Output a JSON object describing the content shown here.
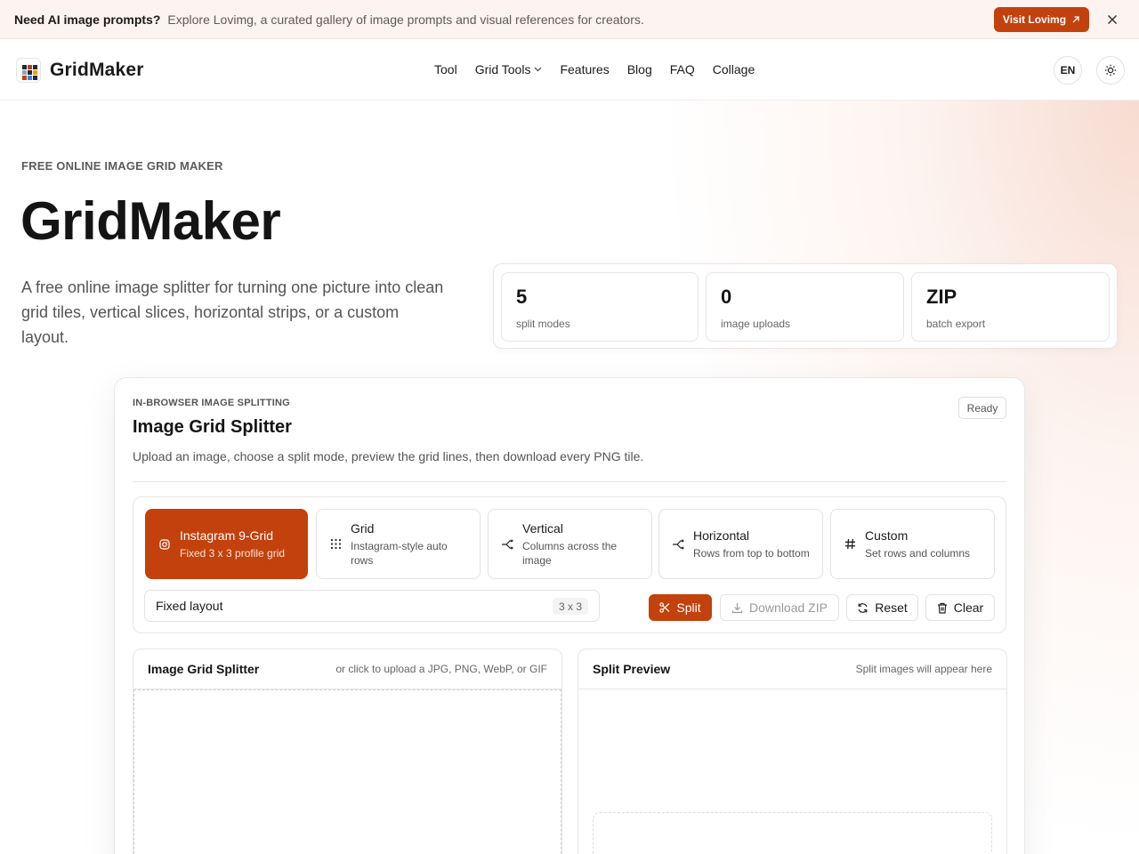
{
  "banner": {
    "headline": "Need AI image prompts?",
    "description": "Explore Lovimg, a curated gallery of image prompts and visual references for creators.",
    "cta_label": "Visit Lovimg",
    "cta_icon": "arrow-up-right-icon",
    "close_icon": "close-icon"
  },
  "nav": {
    "brand": "GridMaker",
    "items": [
      {
        "label": "Tool"
      },
      {
        "label": "Grid Tools",
        "has_dropdown": true
      },
      {
        "label": "Features"
      },
      {
        "label": "Blog"
      },
      {
        "label": "FAQ"
      },
      {
        "label": "Collage"
      }
    ],
    "language": "EN",
    "theme_icon": "sun-icon"
  },
  "hero": {
    "eyebrow": "FREE ONLINE IMAGE GRID MAKER",
    "title": "GridMaker",
    "subtitle": "A free online image splitter for turning one picture into clean grid tiles, vertical slices, horizontal strips, or a custom layout.",
    "stats": [
      {
        "value": "5",
        "label": "split modes"
      },
      {
        "value": "0",
        "label": "image uploads"
      },
      {
        "value": "ZIP",
        "label": "batch export"
      }
    ]
  },
  "tool": {
    "caption": "IN-BROWSER IMAGE SPLITTING",
    "title": "Image Grid Splitter",
    "description": "Upload an image, choose a split mode, preview the grid lines, then download every PNG tile.",
    "status": "Ready",
    "modes": [
      {
        "title": "Instagram 9-Grid",
        "subtitle": "Fixed 3 x 3 profile grid",
        "icon": "instagram-icon",
        "active": true
      },
      {
        "title": "Grid",
        "subtitle": "Instagram-style auto rows",
        "icon": "grid-dots-icon",
        "active": false
      },
      {
        "title": "Vertical",
        "subtitle": "Columns across the image",
        "icon": "split-vertical-icon",
        "active": false
      },
      {
        "title": "Horizontal",
        "subtitle": "Rows from top to bottom",
        "icon": "split-horizontal-icon",
        "active": false
      },
      {
        "title": "Custom",
        "subtitle": "Set rows and columns",
        "icon": "hash-icon",
        "active": false
      }
    ],
    "layout_label": "Fixed layout",
    "layout_value": "3 x 3",
    "actions": {
      "split": "Split",
      "download": "Download ZIP",
      "reset": "Reset",
      "clear": "Clear"
    },
    "upload_panel": {
      "title": "Image Grid Splitter",
      "hint": "or click to upload a JPG, PNG, WebP, or GIF"
    },
    "preview_panel": {
      "title": "Split Preview",
      "hint": "Split images will appear here"
    }
  },
  "colors": {
    "accent": "#c2410c",
    "banner_bg": "#fdf4f1",
    "text": "#1a1a1a",
    "muted": "#555555",
    "border": "#e6e6e6"
  }
}
